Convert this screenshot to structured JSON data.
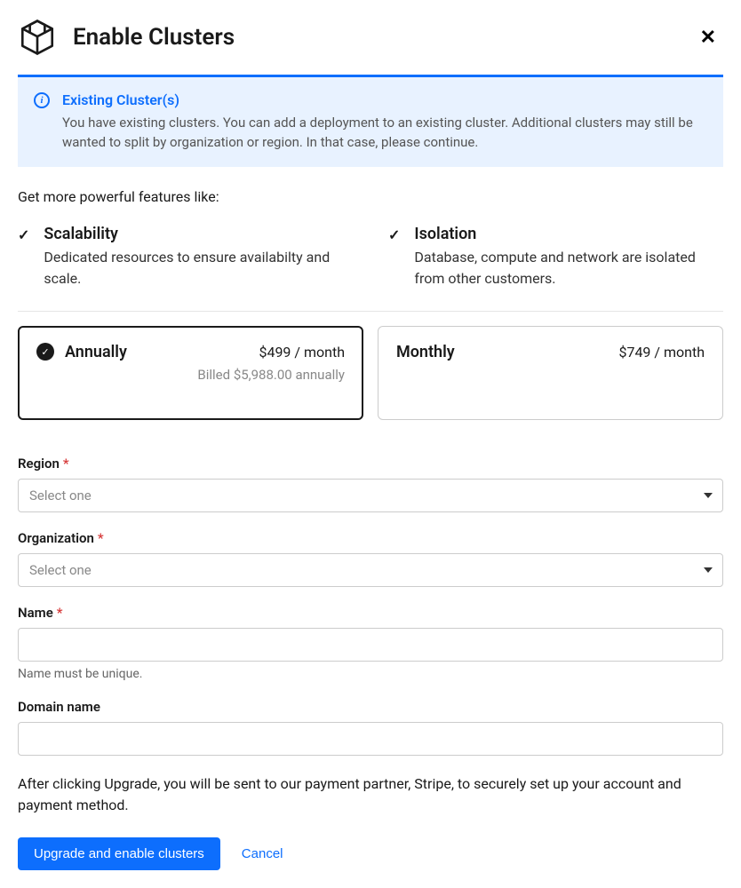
{
  "header": {
    "title": "Enable Clusters"
  },
  "banner": {
    "title": "Existing Cluster(s)",
    "text": "You have existing clusters. You can add a deployment to an existing cluster. Additional clusters may still be wanted to split by organization or region. In that case, please continue."
  },
  "intro": "Get more powerful features like:",
  "features": [
    {
      "title": "Scalability",
      "desc": "Dedicated resources to ensure availabilty and scale."
    },
    {
      "title": "Isolation",
      "desc": "Database, compute and network are isolated from other customers."
    }
  ],
  "plans": {
    "annually": {
      "name": "Annually",
      "price": "$499 / month",
      "sub": "Billed $5,988.00 annually"
    },
    "monthly": {
      "name": "Monthly",
      "price": "$749 / month"
    }
  },
  "form": {
    "region_label": "Region",
    "region_placeholder": "Select one",
    "org_label": "Organization",
    "org_placeholder": "Select one",
    "name_label": "Name",
    "name_help": "Name must be unique.",
    "domain_label": "Domain name"
  },
  "payment_note": "After clicking Upgrade, you will be sent to our payment partner, Stripe, to securely set up your account and payment method.",
  "actions": {
    "primary": "Upgrade and enable clusters",
    "cancel": "Cancel"
  }
}
